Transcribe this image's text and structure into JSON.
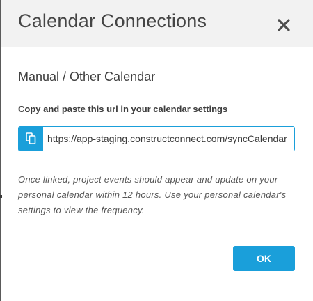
{
  "dialog": {
    "title": "Calendar Connections",
    "close_icon": "close-icon"
  },
  "section": {
    "heading": "Manual / Other Calendar",
    "instruction": "Copy and paste this url in your calendar settings",
    "url_value": "https://app-staging.constructconnect.com/syncCalendar",
    "copy_icon": "copy-icon",
    "note": "Once linked, project events should appear and update on your personal calendar within 12 hours. Use your personal calendar's settings to view the frequency."
  },
  "actions": {
    "ok_label": "OK"
  },
  "colors": {
    "accent": "#1a9fda",
    "header_bg": "#f2f2f2",
    "title_text": "#454545",
    "body_text": "#3d3d3d"
  }
}
